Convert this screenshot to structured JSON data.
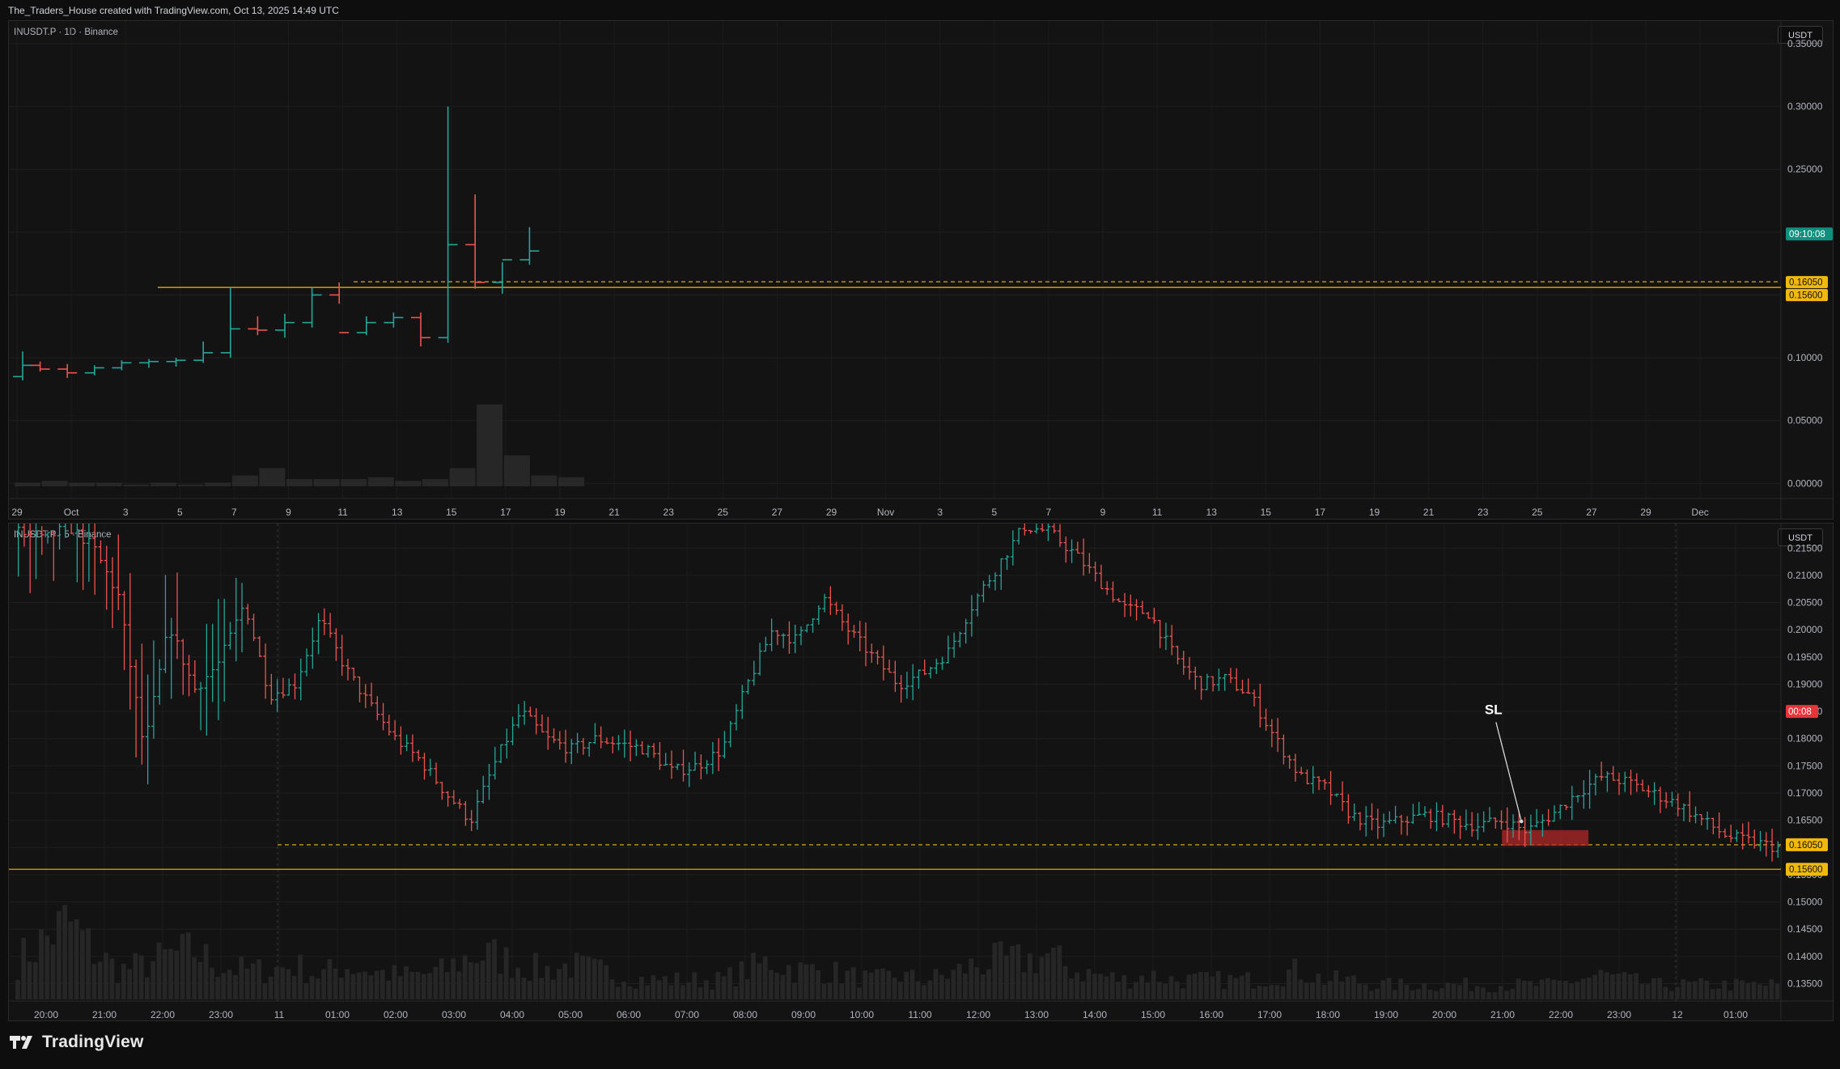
{
  "header": {
    "credit": "The_Traders_House created with TradingView.com, Oct 13, 2025 14:49 UTC"
  },
  "footer": {
    "brand": "TradingView"
  },
  "colors": {
    "up": "#26a69a",
    "down": "#ef5350",
    "level": "#f0b90b",
    "sl_zone": "#b22a2a",
    "countdown_top": "#0f8f7d",
    "countdown_bottom": "#e8323c"
  },
  "chart_data": [
    {
      "type": "ohlc",
      "symbol_label": "INUSDT.P · 1D · Binance",
      "currency": "USDT",
      "y_ticks": [
        "0.35000",
        "0.30000",
        "0.25000",
        "0.20000",
        "0.15000",
        "0.10000",
        "0.05000",
        "0.00000"
      ],
      "ylim": [
        -0.012,
        0.368
      ],
      "x_ticks": [
        "29",
        "Oct",
        "3",
        "5",
        "7",
        "9",
        "11",
        "13",
        "15",
        "17",
        "19",
        "21",
        "23",
        "25",
        "27",
        "29",
        "Nov",
        "3",
        "5",
        "7",
        "9",
        "11",
        "13",
        "15",
        "17",
        "19",
        "21",
        "23",
        "25",
        "27",
        "29",
        "Dec"
      ],
      "bars": [
        {
          "o": 0.085,
          "h": 0.105,
          "l": 0.082,
          "c": 0.094
        },
        {
          "o": 0.094,
          "h": 0.097,
          "l": 0.089,
          "c": 0.091
        },
        {
          "o": 0.091,
          "h": 0.095,
          "l": 0.084,
          "c": 0.088
        },
        {
          "o": 0.088,
          "h": 0.094,
          "l": 0.086,
          "c": 0.092
        },
        {
          "o": 0.092,
          "h": 0.098,
          "l": 0.09,
          "c": 0.096
        },
        {
          "o": 0.096,
          "h": 0.099,
          "l": 0.092,
          "c": 0.097
        },
        {
          "o": 0.097,
          "h": 0.1,
          "l": 0.093,
          "c": 0.098
        },
        {
          "o": 0.098,
          "h": 0.113,
          "l": 0.096,
          "c": 0.104
        },
        {
          "o": 0.104,
          "h": 0.156,
          "l": 0.1,
          "c": 0.123
        },
        {
          "o": 0.123,
          "h": 0.133,
          "l": 0.118,
          "c": 0.122
        },
        {
          "o": 0.122,
          "h": 0.135,
          "l": 0.116,
          "c": 0.128
        },
        {
          "o": 0.128,
          "h": 0.156,
          "l": 0.124,
          "c": 0.15
        },
        {
          "o": 0.15,
          "h": 0.16,
          "l": 0.143,
          "c": 0.12
        },
        {
          "o": 0.12,
          "h": 0.133,
          "l": 0.118,
          "c": 0.128
        },
        {
          "o": 0.128,
          "h": 0.136,
          "l": 0.124,
          "c": 0.132
        },
        {
          "o": 0.132,
          "h": 0.136,
          "l": 0.109,
          "c": 0.116
        },
        {
          "o": 0.116,
          "h": 0.3,
          "l": 0.112,
          "c": 0.19
        },
        {
          "o": 0.19,
          "h": 0.23,
          "l": 0.155,
          "c": 0.16
        },
        {
          "o": 0.16,
          "h": 0.176,
          "l": 0.151,
          "c": 0.178
        },
        {
          "o": 0.178,
          "h": 0.204,
          "l": 0.174,
          "c": 0.185
        }
      ],
      "volume": [
        2,
        3,
        2,
        2,
        1,
        2,
        1,
        2,
        6,
        10,
        4,
        4,
        4,
        5,
        3,
        4,
        10,
        45,
        17,
        6,
        5
      ],
      "levels": [
        {
          "value": 0.1605,
          "label": "0.16050",
          "style": "dashed"
        },
        {
          "value": 0.156,
          "label": "0.15600",
          "style": "solid"
        }
      ],
      "countdown": {
        "label": "09:10:08",
        "value": 0.1985
      }
    },
    {
      "type": "ohlc",
      "symbol_label": "INUSDT.P · 5 · Binance",
      "currency": "USDT",
      "y_ticks": [
        "0.21500",
        "0.21000",
        "0.20500",
        "0.20000",
        "0.19500",
        "0.19000",
        "0.18500",
        "0.18000",
        "0.17500",
        "0.17000",
        "0.16500",
        "0.16000",
        "0.15500",
        "0.15000",
        "0.14500",
        "0.14000",
        "0.13500"
      ],
      "ylim": [
        0.1318,
        0.2195
      ],
      "x_ticks": [
        "20:00",
        "21:00",
        "22:00",
        "23:00",
        "11",
        "01:00",
        "02:00",
        "03:00",
        "04:00",
        "05:00",
        "06:00",
        "07:00",
        "08:00",
        "09:00",
        "10:00",
        "11:00",
        "12:00",
        "13:00",
        "14:00",
        "15:00",
        "16:00",
        "17:00",
        "18:00",
        "19:00",
        "20:00",
        "21:00",
        "22:00",
        "23:00",
        "12",
        "01:00"
      ],
      "anchor_points": [
        [
          0,
          0.218
        ],
        [
          1,
          0.2165
        ],
        [
          2,
          0.219
        ],
        [
          3,
          0.215
        ],
        [
          4,
          0.206
        ],
        [
          5,
          0.178
        ],
        [
          6,
          0.201
        ],
        [
          7,
          0.189
        ],
        [
          8,
          0.194
        ],
        [
          9,
          0.205
        ],
        [
          10,
          0.188
        ],
        [
          11,
          0.19
        ],
        [
          12,
          0.202
        ],
        [
          13,
          0.193
        ],
        [
          14,
          0.186
        ],
        [
          15,
          0.18
        ],
        [
          16,
          0.176
        ],
        [
          17,
          0.17
        ],
        [
          18,
          0.165
        ],
        [
          19,
          0.176
        ],
        [
          20,
          0.185
        ],
        [
          21,
          0.18
        ],
        [
          22,
          0.178
        ],
        [
          23,
          0.18
        ],
        [
          24,
          0.179
        ],
        [
          25,
          0.178
        ],
        [
          26,
          0.174
        ],
        [
          27,
          0.175
        ],
        [
          28,
          0.178
        ],
        [
          29,
          0.19
        ],
        [
          30,
          0.2
        ],
        [
          31,
          0.198
        ],
        [
          32,
          0.206
        ],
        [
          33,
          0.2
        ],
        [
          34,
          0.195
        ],
        [
          35,
          0.19
        ],
        [
          36,
          0.192
        ],
        [
          37,
          0.196
        ],
        [
          38,
          0.205
        ],
        [
          39,
          0.212
        ],
        [
          40,
          0.219
        ],
        [
          41,
          0.218
        ],
        [
          42,
          0.214
        ],
        [
          43,
          0.209
        ],
        [
          44,
          0.204
        ],
        [
          45,
          0.203
        ],
        [
          46,
          0.195
        ],
        [
          47,
          0.19
        ],
        [
          48,
          0.191
        ],
        [
          49,
          0.188
        ],
        [
          50,
          0.18
        ],
        [
          51,
          0.173
        ],
        [
          52,
          0.171
        ],
        [
          53,
          0.166
        ],
        [
          54,
          0.164
        ],
        [
          55,
          0.165
        ],
        [
          56,
          0.166
        ],
        [
          57,
          0.165
        ],
        [
          58,
          0.164
        ],
        [
          59,
          0.165
        ],
        [
          60,
          0.163
        ],
        [
          61,
          0.166
        ],
        [
          62,
          0.17
        ],
        [
          63,
          0.173
        ],
        [
          64,
          0.172
        ],
        [
          65,
          0.17
        ],
        [
          66,
          0.168
        ],
        [
          67,
          0.165
        ],
        [
          68,
          0.162
        ],
        [
          69,
          0.161
        ],
        [
          70,
          0.16
        ]
      ],
      "volume_levels": [
        0.8,
        1.2,
        1.6,
        1.0,
        0.6,
        0.7,
        0.9,
        1.0,
        0.7,
        0.6,
        0.6,
        0.7,
        0.5,
        0.7,
        0.6,
        0.5,
        0.5,
        0.6,
        0.9,
        0.9,
        0.7,
        0.6,
        0.7,
        0.6,
        0.5,
        0.4,
        0.4,
        0.4,
        0.4,
        0.6,
        0.8,
        0.6,
        0.6,
        0.5,
        0.4,
        0.5,
        0.4,
        0.5,
        0.7,
        0.8,
        0.8,
        0.9,
        0.6,
        0.5,
        0.4,
        0.5,
        0.4,
        0.4,
        0.4,
        0.4,
        0.5,
        0.6,
        0.4,
        0.4,
        0.3,
        0.3,
        0.3,
        0.3,
        0.3,
        0.3,
        0.3,
        0.3,
        0.4,
        0.5,
        0.4,
        0.3,
        0.3,
        0.3,
        0.3,
        0.3,
        0.3
      ],
      "levels": [
        {
          "value": 0.1605,
          "label": "0.16050",
          "style": "dashed"
        },
        {
          "value": 0.156,
          "label": "0.15600",
          "style": "solid"
        }
      ],
      "countdown": {
        "label": "00:08",
        "value": 0.185
      },
      "annotations": [
        {
          "text": "SL",
          "x_frac": 0.8322,
          "y": 0.1845,
          "arrow_to_x_frac": 0.853,
          "arrow_to_y": 0.1648
        }
      ],
      "sl_zone": {
        "x_start_frac": 0.842,
        "x_end_frac": 0.891,
        "y_top": 0.1632,
        "y_bottom": 0.1603
      }
    }
  ]
}
